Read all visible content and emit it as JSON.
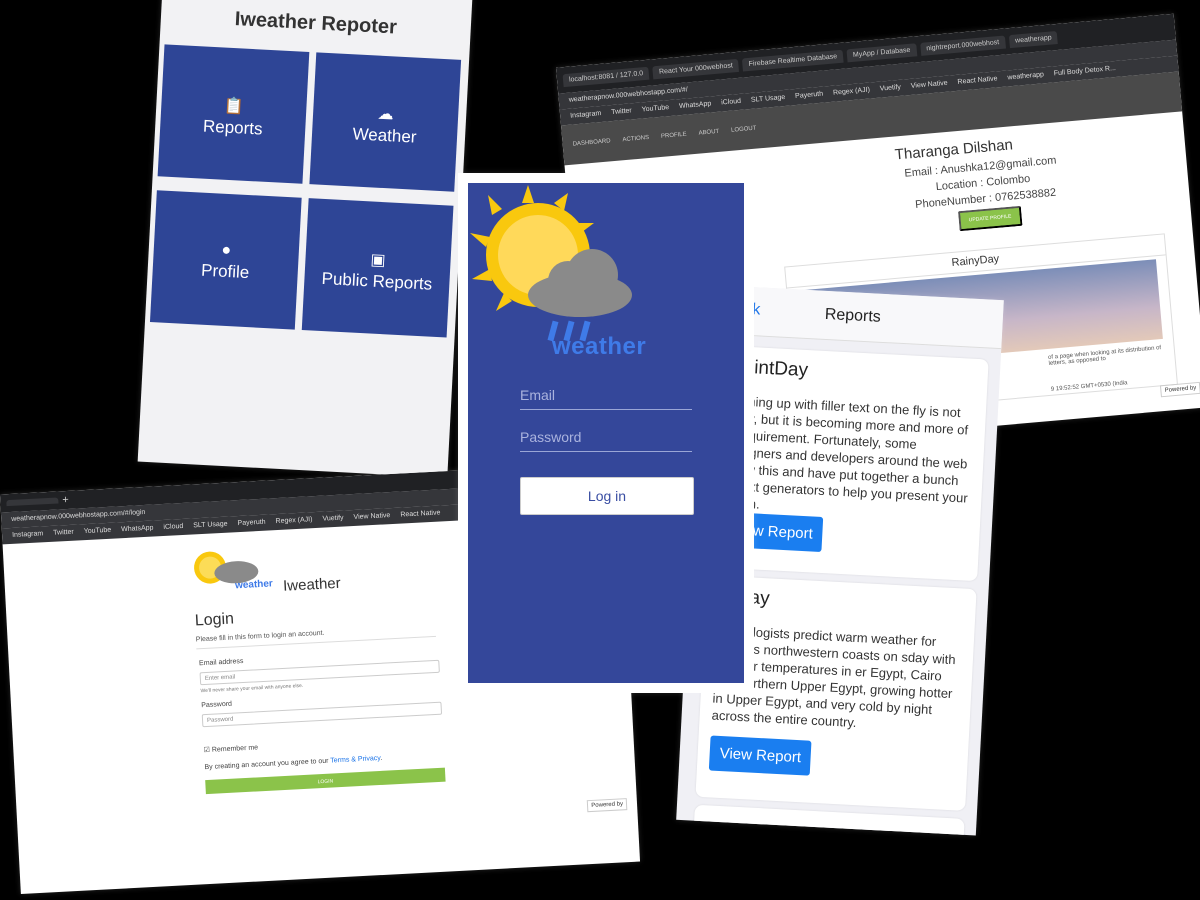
{
  "dashboard": {
    "title": "Iweather Repoter",
    "tiles": [
      "Reports",
      "Weather",
      "Profile",
      "Public Reports"
    ]
  },
  "profile_page": {
    "tabs": [
      "localhost:8081 / 127.0.0",
      "React Your 000webhost",
      "Firebase Realtime Database",
      "MyApp / Database",
      "nightreport.000webhost",
      "weatherapp"
    ],
    "url": "weatherapnow.000webhostapp.com/#/",
    "bookmarks": [
      "Instagram",
      "Twitter",
      "YouTube",
      "WhatsApp",
      "iCloud",
      "SLT Usage",
      "Payeruth",
      "Regex (AJI)",
      "Vuetify",
      "View Native",
      "React Native",
      "weatherapp",
      "Full Body Detox R..."
    ],
    "menu": [
      "DASHBOARD",
      "ACTIONS",
      "PROFILE",
      "ABOUT",
      "LOGOUT"
    ],
    "name": "Tharanga Dilshan",
    "email": "Email : Anushka12@gmail.com",
    "location": "Location : Colombo",
    "phone": "PhoneNumber : 0762538882",
    "update_button": "UPDATE PROFILE",
    "report_title": "RainyDay",
    "report_text": "of a page when looking at its distribution of letters, as opposed to",
    "report_time": "9 19:52:52 GMT+0530 (India",
    "powered": "Powered by"
  },
  "login_page": {
    "url": "weatherapnow.000webhostapp.com/#/login",
    "bookmarks": [
      "Instagram",
      "Twitter",
      "YouTube",
      "WhatsApp",
      "iCloud",
      "SLT Usage",
      "Payeruth",
      "Regex (AJI)",
      "Vuetify",
      "View Native",
      "React Native"
    ],
    "app_name": "Iweather",
    "logo_word": "weather",
    "heading": "Login",
    "subheading": "Please fill in this form to login an account.",
    "email_label": "Email address",
    "email_placeholder": "Enter email",
    "email_hint": "We'll never share your email with anyone else.",
    "password_label": "Password",
    "password_placeholder": "Password",
    "remember": "Remember me",
    "terms_prefix": "By creating an account you agree to our",
    "terms_link": "Terms & Privacy",
    "login_button": "LOGIN",
    "powered": "Powered by"
  },
  "mobile_login": {
    "brand": "weather",
    "email_placeholder": "Email",
    "password_placeholder": "Password",
    "button": "Log in"
  },
  "reports_page": {
    "back": "Back",
    "title": "Reports",
    "cards": [
      {
        "title": "RaintDay",
        "body": "Coming up with filler text on the fly is not easy, but it is becoming more and more of a requirement. Fortunately, some designers and developers around the web know this and have put together a bunch of text generators to help you present your vision.",
        "button": "View Report"
      },
      {
        "title": "oftday",
        "body": "eteorologists predict warm weather for ptâ€™s northwestern coasts on sday with warmer temperatures in er Egypt, Cairo and northern Upper Egypt, growing hotter in Upper Egypt, and very cold by night across the entire country.",
        "button": "View Report"
      }
    ]
  },
  "colors": {
    "primary_blue": "#34479a",
    "tile_blue": "#2e4596",
    "accent_green": "#8bc34a",
    "link_blue": "#1a7ef0",
    "sun_yellow": "#f9c80e",
    "cloud_grey": "#8a8a8a"
  }
}
